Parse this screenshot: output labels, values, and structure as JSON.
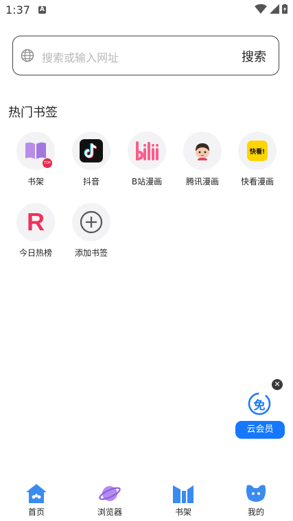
{
  "status": {
    "time": "1:37",
    "notification_letter": "A"
  },
  "search": {
    "placeholder": "搜索或输入网址",
    "button_label": "搜索"
  },
  "section": {
    "title": "热门书签"
  },
  "bookmarks": [
    {
      "label": "书架"
    },
    {
      "label": "抖音"
    },
    {
      "label": "B站漫画"
    },
    {
      "label": "腾讯漫画"
    },
    {
      "label": "快看漫画"
    },
    {
      "label": "今日热榜"
    },
    {
      "label": "添加书签"
    }
  ],
  "bookmark_badges": {
    "bookshelf_badge": "TOP",
    "kuaikan_text": "快看!",
    "rebang_letter": "R"
  },
  "promo": {
    "badge_text": "免",
    "label": "云会员"
  },
  "nav": [
    {
      "label": "首页"
    },
    {
      "label": "浏览器"
    },
    {
      "label": "书架"
    },
    {
      "label": "我的"
    }
  ],
  "colors": {
    "accent": "#1677ff",
    "brand_pink": "#fb5c8a",
    "rebang_red": "#f0315b"
  }
}
